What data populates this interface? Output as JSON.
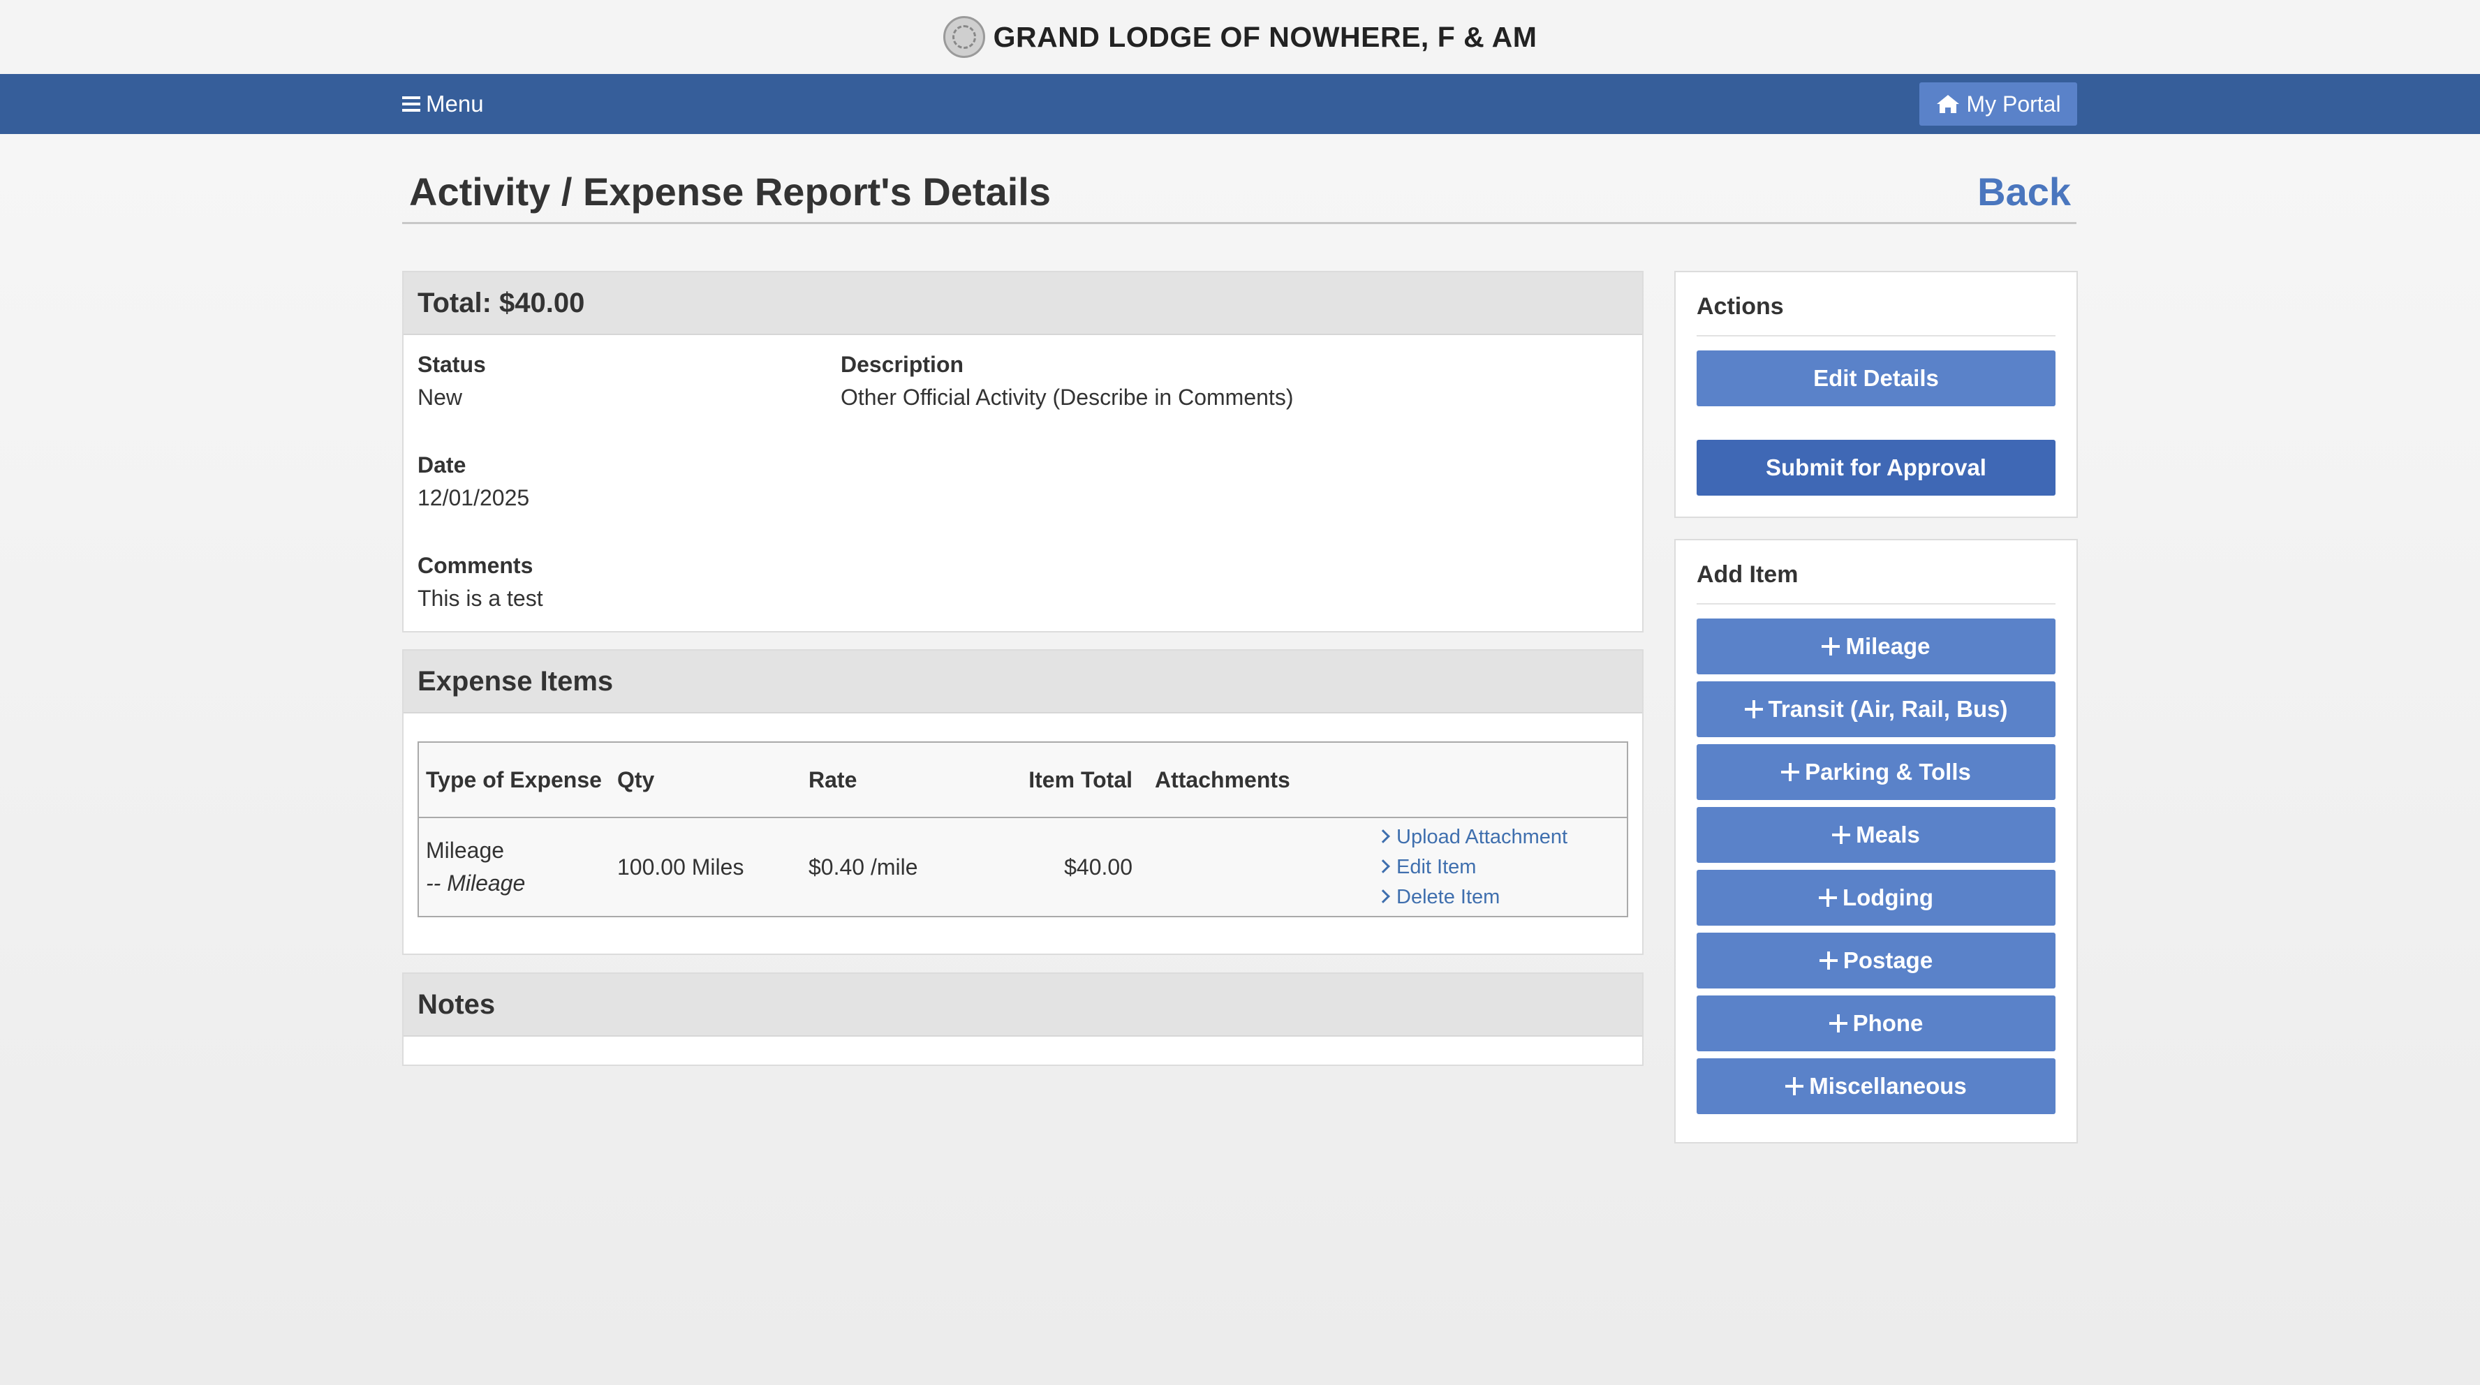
{
  "site": {
    "title": "GRAND LODGE OF NOWHERE, F & AM",
    "logo_icon": "lodge-seal-icon"
  },
  "nav": {
    "menu_label": "Menu",
    "portal_label": "My Portal",
    "nav_color": "#365e9a"
  },
  "page": {
    "title": "Activity / Expense Report's Details",
    "back_label": "Back"
  },
  "summary": {
    "total_label": "Total: $40.00",
    "status_label": "Status",
    "status_value": "New",
    "description_label": "Description",
    "description_value": "Other Official Activity (Describe in Comments)",
    "date_label": "Date",
    "date_value": "12/01/2025",
    "comments_label": "Comments",
    "comments_value": "This is a test"
  },
  "expense_items": {
    "heading": "Expense Items",
    "columns": [
      "Type of Expense",
      "Qty",
      "Rate",
      "Item Total",
      "Attachments"
    ],
    "rows": [
      {
        "type": "Mileage",
        "subtype": "-- Mileage",
        "qty": "100.00 Miles",
        "rate": "$0.40 /mile",
        "total": "$40.00",
        "actions": [
          "Upload Attachment",
          "Edit Item",
          "Delete Item"
        ]
      }
    ]
  },
  "notes": {
    "heading": "Notes"
  },
  "actions": {
    "heading": "Actions",
    "edit_label": "Edit Details",
    "submit_label": "Submit for Approval"
  },
  "add_item": {
    "heading": "Add Item",
    "buttons": [
      "Mileage",
      "Transit (Air, Rail, Bus)",
      "Parking & Tolls",
      "Meals",
      "Lodging",
      "Postage",
      "Phone",
      "Miscellaneous"
    ]
  }
}
